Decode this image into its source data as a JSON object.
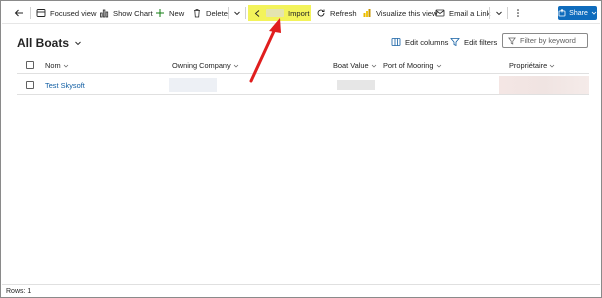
{
  "toolbar": {
    "back_icon": "back-arrow-icon",
    "focused_view": "Focused view",
    "show_chart": "Show Chart",
    "new": "New",
    "delete": "Delete",
    "import": "Import",
    "refresh": "Refresh",
    "visualize": "Visualize this view",
    "email_link": "Email a Link",
    "share": "Share",
    "highlight_color": "#f3f35a"
  },
  "view": {
    "title": "All Boats",
    "edit_columns": "Edit columns",
    "edit_filters": "Edit filters",
    "search_placeholder": "Filter by keyword"
  },
  "grid": {
    "columns": [
      "Nom",
      "Owning Company",
      "Boat Value",
      "Port of Mooring",
      "Propriétaire"
    ],
    "rows": [
      {
        "nom": "Test Skysoft"
      }
    ]
  },
  "footer": {
    "rows_label": "Rows: 1"
  },
  "colors": {
    "accent": "#0f6cbd",
    "link": "#115ea3",
    "annotation_arrow": "#e01e1e"
  }
}
